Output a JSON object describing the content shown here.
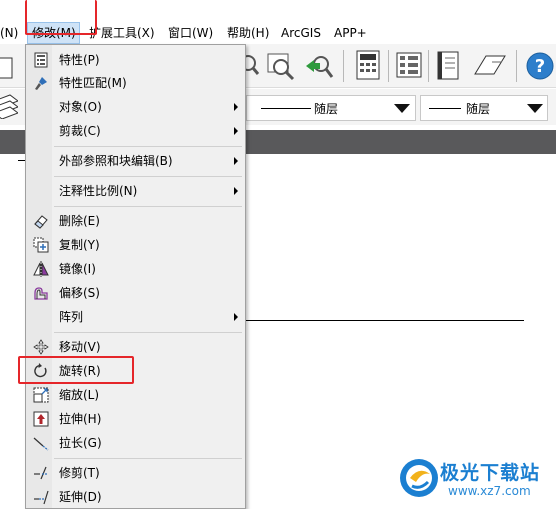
{
  "menubar": {
    "items": [
      {
        "label": "(N)"
      },
      {
        "label": "修改(M)"
      },
      {
        "label": "扩展工具(X)"
      },
      {
        "label": "窗口(W)"
      },
      {
        "label": "帮助(H)"
      },
      {
        "label": "ArcGIS"
      },
      {
        "label": "APP+"
      }
    ]
  },
  "layer_dropdowns": [
    {
      "value": "随层"
    },
    {
      "value": "随层"
    }
  ],
  "modify_menu": {
    "items": [
      {
        "label": "特性(P)",
        "icon": "properties-icon"
      },
      {
        "label": "特性匹配(M)",
        "icon": "match-brush-icon"
      },
      {
        "label": "对象(O)",
        "submenu": true
      },
      {
        "label": "剪裁(C)",
        "submenu": true
      },
      {
        "label": "外部参照和块编辑(B)",
        "submenu": true
      },
      {
        "label": "注释性比例(N)",
        "submenu": true
      },
      {
        "label": "删除(E)",
        "icon": "eraser-icon"
      },
      {
        "label": "复制(Y)",
        "icon": "copy-icon"
      },
      {
        "label": "镜像(I)",
        "icon": "mirror-icon"
      },
      {
        "label": "偏移(S)",
        "icon": "offset-icon"
      },
      {
        "label": "阵列",
        "submenu": true
      },
      {
        "label": "移动(V)",
        "icon": "move-icon"
      },
      {
        "label": "旋转(R)",
        "icon": "rotate-icon"
      },
      {
        "label": "缩放(L)",
        "icon": "scale-icon"
      },
      {
        "label": "拉伸(H)",
        "icon": "stretch-icon"
      },
      {
        "label": "拉长(G)",
        "icon": "lengthen-icon"
      },
      {
        "label": "修剪(T)",
        "icon": "trim-icon"
      },
      {
        "label": "延伸(D)",
        "icon": "extend-icon"
      }
    ]
  },
  "watermark": {
    "title": "极光下载站",
    "url": "www.xz7.com"
  },
  "colors": {
    "highlight_box": "#e5262a",
    "active_menu_bg": "#cfe3f7",
    "menu_bg": "#f0f0f0",
    "dark_bar": "#59595b",
    "watermark_blue": "#1b7fd1"
  }
}
